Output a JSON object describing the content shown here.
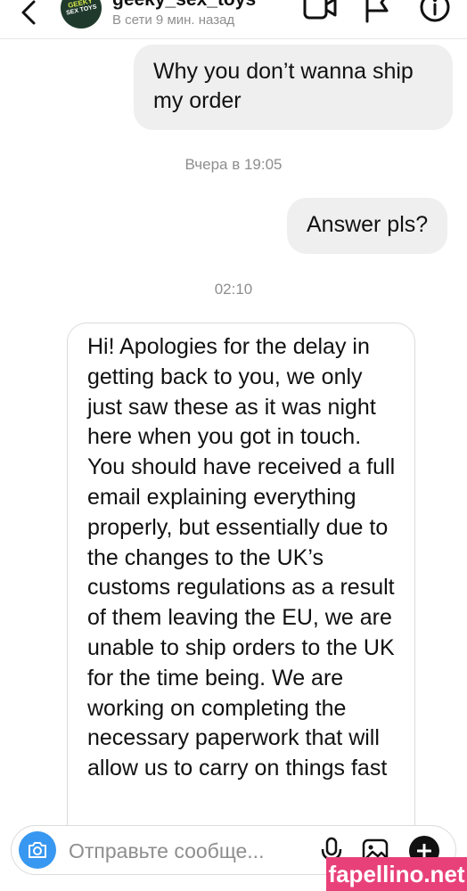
{
  "header": {
    "username": "geeky_sex_toys",
    "status": "В сети 9 мин. назад",
    "avatar_text": [
      "GEEKY",
      "SEX TOYS"
    ],
    "icons": [
      "back-arrow-icon",
      "video-call-icon",
      "flag-icon",
      "info-icon"
    ]
  },
  "messages": [
    {
      "direction": "outgoing",
      "text": "Why you don’t wanna ship my order"
    },
    {
      "type": "timestamp",
      "text": "Вчера в 19:05"
    },
    {
      "direction": "outgoing",
      "text": "Answer pls?"
    },
    {
      "type": "timestamp",
      "text": "02:10"
    },
    {
      "direction": "incoming",
      "text": "Hi! Apologies for the delay in getting back to you, we only just saw these as it was night here when you got in touch. You should have received a full email explaining everything properly, but essentially due to the changes to the UK’s customs regulations as a result of them leaving the EU, we are unable to ship orders to the UK for the time being. We are working on completing the necessary paperwork that will allow us to carry on things fast"
    }
  ],
  "composer": {
    "placeholder": "Отправьте сообще...",
    "icons": [
      "camera-icon",
      "microphone-icon",
      "gallery-icon",
      "plus-icon"
    ]
  },
  "watermark": "fapellino.net",
  "colors": {
    "camera_button": "#3897f0",
    "bubble_outgoing": "#efefef",
    "watermark": "#e8417a"
  }
}
